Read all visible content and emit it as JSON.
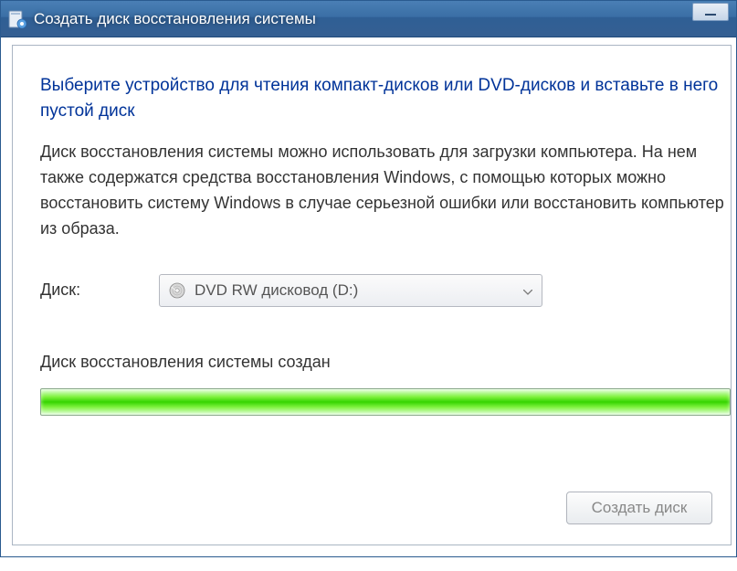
{
  "titlebar": {
    "title": "Создать диск восстановления системы"
  },
  "content": {
    "heading": "Выберите устройство для чтения компакт-дисков или DVD-дисков и вставьте в него пустой диск",
    "description": "Диск восстановления системы можно использовать для загрузки компьютера. На нем также содержатся средства восстановления Windows, с помощью которых можно восстановить систему Windows в случае серьезной ошибки или восстановить компьютер из образа.",
    "drive_label": "Диск:",
    "drive_selected": "DVD RW дисковод (D:)",
    "status": "Диск восстановления системы создан"
  },
  "buttons": {
    "create": "Создать диск"
  }
}
